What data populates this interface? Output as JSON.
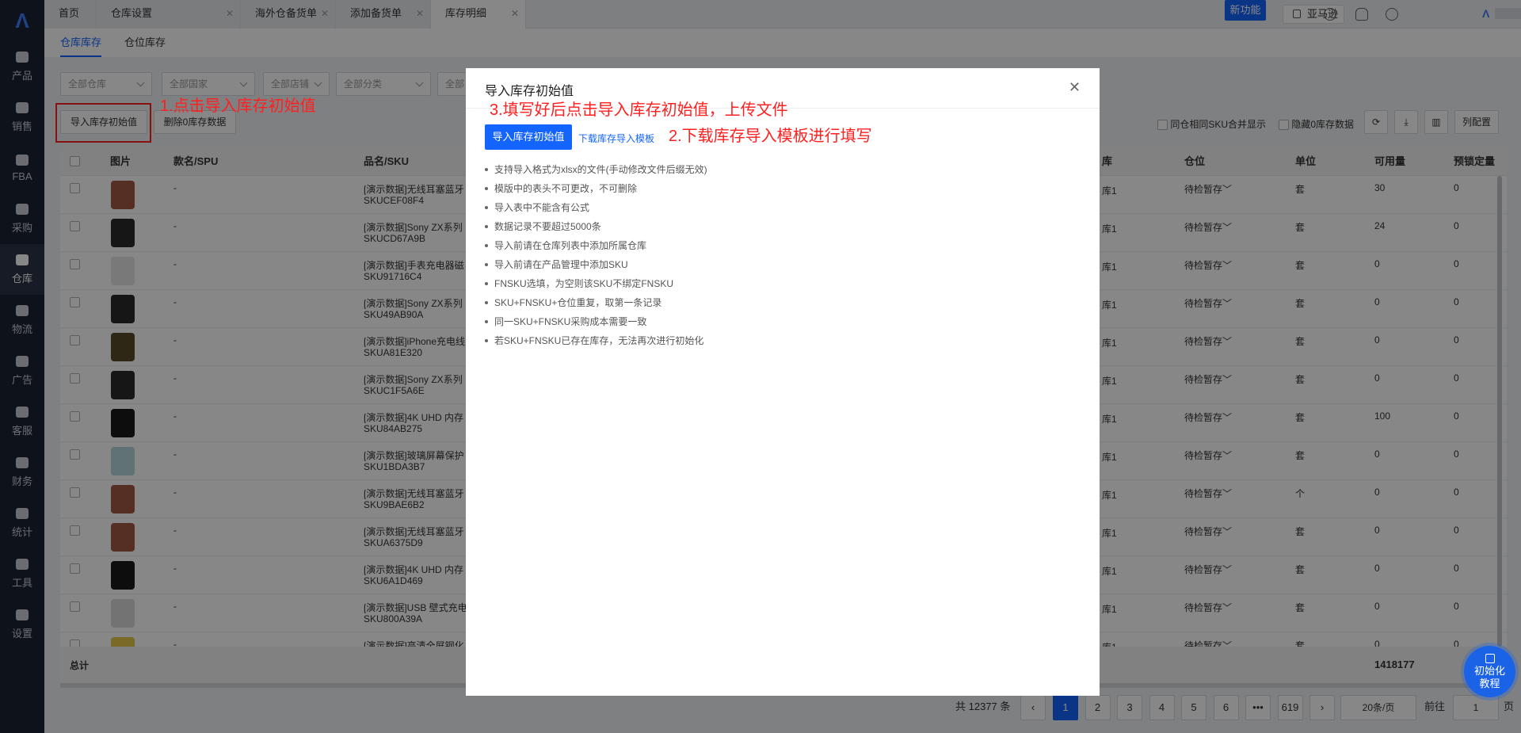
{
  "sidebar": {
    "items": [
      {
        "label": "产品"
      },
      {
        "label": "销售"
      },
      {
        "label": "FBA"
      },
      {
        "label": "采购"
      },
      {
        "label": "仓库"
      },
      {
        "label": "物流"
      },
      {
        "label": "广告"
      },
      {
        "label": "客服"
      },
      {
        "label": "财务"
      },
      {
        "label": "统计"
      },
      {
        "label": "工具"
      },
      {
        "label": "设置"
      }
    ],
    "active": "仓库"
  },
  "tabs": [
    {
      "label": "首页"
    },
    {
      "label": "仓库设置"
    },
    {
      "label": "海外仓备货单"
    },
    {
      "label": "添加备货单"
    },
    {
      "label": "库存明细"
    }
  ],
  "header": {
    "new_feature": "新功能",
    "marketplace": "亚马逊"
  },
  "subtabs": [
    {
      "label": "仓库库存"
    },
    {
      "label": "仓位库存"
    }
  ],
  "filters": [
    "全部仓库",
    "全部国家",
    "全部店铺",
    "全部分类",
    "全部"
  ],
  "actions": {
    "import_init": "导入库存初始值",
    "delete_zero": "删除0库存数据"
  },
  "toolbar": {
    "merge_sku": "同仓相同SKU合并显示",
    "hide_zero": "隐藏0库存数据",
    "columns": "列配置"
  },
  "annotations": {
    "step1": "1.点击导入库存初始值",
    "step2": "2.下载库存导入模板进行填写",
    "step3": "3.填写好后点击导入库存初始值，上传文件"
  },
  "table": {
    "headers": {
      "image": "图片",
      "spu": "款名/SPU",
      "name": "品名/SKU",
      "warehouse": "库",
      "location": "仓位",
      "unit": "单位",
      "available": "可用量",
      "locked": "预锁定量"
    },
    "rows": [
      {
        "name": "[演示数据]无线耳塞蓝牙",
        "sku": "SKUCEF08F4",
        "spu": "-",
        "wh": "库1",
        "loc": "待检暂存",
        "unit": "套",
        "avail": "30",
        "locked": "0"
      },
      {
        "name": "[演示数据]Sony ZX系列",
        "sku": "SKUCD67A9B",
        "spu": "-",
        "wh": "库1",
        "loc": "待检暂存",
        "unit": "套",
        "avail": "24",
        "locked": "0"
      },
      {
        "name": "[演示数据]手表充电器磁",
        "sku": "SKU91716C4",
        "spu": "-",
        "wh": "库1",
        "loc": "待检暂存",
        "unit": "套",
        "avail": "0",
        "locked": "0"
      },
      {
        "name": "[演示数据]Sony ZX系列",
        "sku": "SKU49AB90A",
        "spu": "-",
        "wh": "库1",
        "loc": "待检暂存",
        "unit": "套",
        "avail": "0",
        "locked": "0"
      },
      {
        "name": "[演示数据]iPhone充电线",
        "sku": "SKUA81E320",
        "spu": "-",
        "wh": "库1",
        "loc": "待检暂存",
        "unit": "套",
        "avail": "0",
        "locked": "0"
      },
      {
        "name": "[演示数据]Sony ZX系列",
        "sku": "SKUC1F5A6E",
        "spu": "-",
        "wh": "库1",
        "loc": "待检暂存",
        "unit": "套",
        "avail": "0",
        "locked": "0"
      },
      {
        "name": "[演示数据]4K UHD 内存",
        "sku": "SKU84AB275",
        "spu": "-",
        "wh": "库1",
        "loc": "待检暂存",
        "unit": "套",
        "avail": "100",
        "locked": "0"
      },
      {
        "name": "[演示数据]玻璃屏幕保护",
        "sku": "SKU1BDA3B7",
        "spu": "-",
        "wh": "库1",
        "loc": "待检暂存",
        "unit": "套",
        "avail": "0",
        "locked": "0"
      },
      {
        "name": "[演示数据]无线耳塞蓝牙",
        "sku": "SKU9BAE6B2",
        "spu": "-",
        "wh": "库1",
        "loc": "待检暂存",
        "unit": "个",
        "avail": "0",
        "locked": "0"
      },
      {
        "name": "[演示数据]无线耳塞蓝牙",
        "sku": "SKUA6375D9",
        "spu": "-",
        "wh": "库1",
        "loc": "待检暂存",
        "unit": "套",
        "avail": "0",
        "locked": "0"
      },
      {
        "name": "[演示数据]4K UHD 内存",
        "sku": "SKU6A1D469",
        "spu": "-",
        "wh": "库1",
        "loc": "待检暂存",
        "unit": "套",
        "avail": "0",
        "locked": "0"
      },
      {
        "name": "[演示数据]USB 壁式充电",
        "sku": "SKU800A39A",
        "spu": "-",
        "wh": "库1",
        "loc": "待检暂存",
        "unit": "套",
        "avail": "0",
        "locked": "0"
      },
      {
        "name": "[演示数据]高清全屏钢化",
        "sku": "",
        "spu": "-",
        "wh": "库1",
        "loc": "待检暂存",
        "unit": "套",
        "avail": "0",
        "locked": "0"
      }
    ],
    "total_label": "总计",
    "total_available": "1418177"
  },
  "modal": {
    "title": "导入库存初始值",
    "import_button": "导入库存初始值",
    "template_link": "下载库存导入模板",
    "rules": [
      "支持导入格式为xlsx的文件(手动修改文件后缀无效)",
      "模版中的表头不可更改，不可删除",
      "导入表中不能含有公式",
      "数据记录不要超过5000条",
      "导入前请在仓库列表中添加所属仓库",
      "导入前请在产品管理中添加SKU",
      "FNSKU选填，为空则该SKU不绑定FNSKU",
      "SKU+FNSKU+仓位重复，取第一条记录",
      "同一SKU+FNSKU采购成本需要一致",
      "若SKU+FNSKU已存在库存，无法再次进行初始化"
    ]
  },
  "pagination": {
    "total": "共 12377 条",
    "pages": [
      "1",
      "2",
      "3",
      "4",
      "5",
      "6",
      "•••",
      "619"
    ],
    "page_size": "20条/页",
    "goto_label": "前往",
    "goto_value": "1",
    "page_unit": "页"
  },
  "help": {
    "label": "初始化教程"
  },
  "colors": {
    "primary": "#1464ff",
    "sidebar": "#1c2434",
    "annotation": "#ff2020"
  }
}
